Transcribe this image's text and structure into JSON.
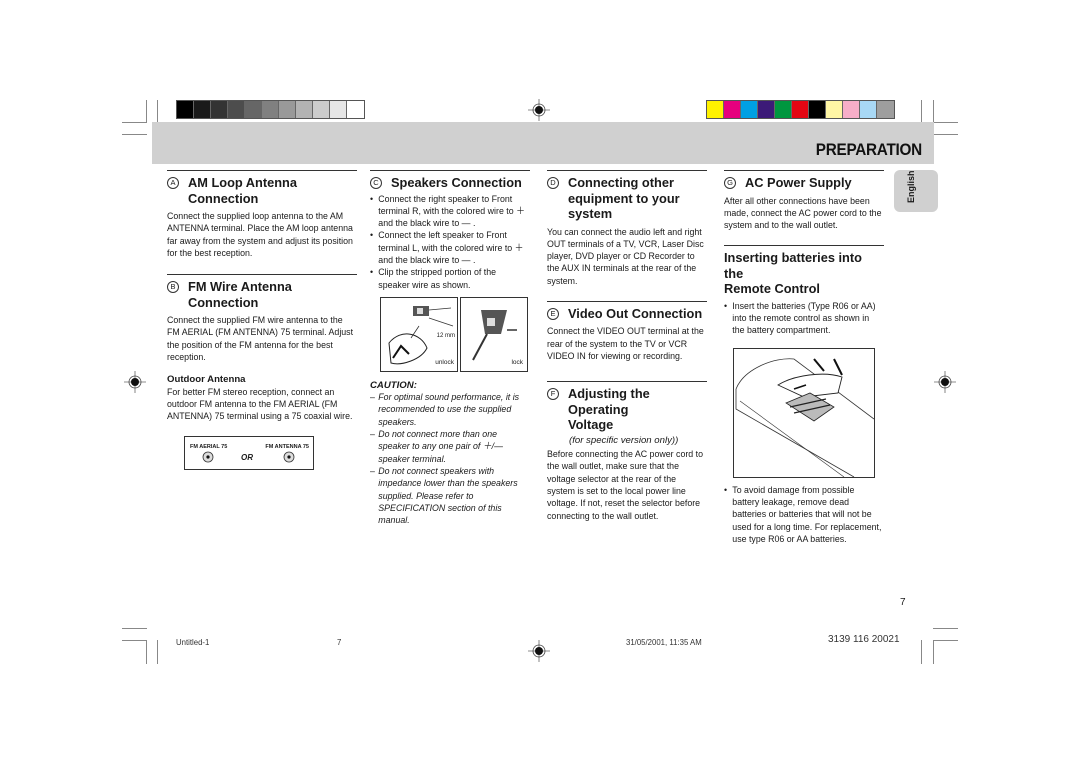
{
  "print_marks": {
    "gray_swatches": [
      "#000000",
      "#1a1a1a",
      "#333333",
      "#4d4d4d",
      "#666666",
      "#808080",
      "#999999",
      "#b3b3b3",
      "#cccccc",
      "#e6e6e6",
      "#ffffff"
    ],
    "color_swatches": [
      "#fff200",
      "#e6007e",
      "#00a0e3",
      "#3c1a78",
      "#00963f",
      "#e30613",
      "#000000",
      "#fff6a5",
      "#f7aec8",
      "#a8d8f5",
      "#9e9e9e"
    ]
  },
  "header": {
    "title": "PREPARATION"
  },
  "side_tab": {
    "label": "English"
  },
  "sections": {
    "a": {
      "letter": "A",
      "title_line1": "AM Loop Antenna",
      "title_line2": "Connection",
      "body": "Connect the supplied loop antenna to the AM ANTENNA terminal. Place the AM loop antenna far away from the system and adjust its position for the best reception."
    },
    "b": {
      "letter": "B",
      "title_line1": "FM Wire Antenna",
      "title_line2": "Connection",
      "body": "Connect the supplied FM wire antenna to the FM AERIAL (FM ANTENNA) 75 terminal. Adjust the position of the FM antenna for the best reception.",
      "sub_title": "Outdoor Antenna",
      "sub_body": "For better FM stereo reception, connect an outdoor FM antenna to the FM AERIAL (FM ANTENNA) 75    terminal using a 75 coaxial wire.",
      "figure": {
        "left_label": "FM AERIAL 75",
        "right_label": "FM ANTENNA 75",
        "or_label": "OR"
      }
    },
    "c": {
      "letter": "C",
      "title": "Speakers Connection",
      "bullets": [
        "Connect the right speaker to Front terminal R, with the colored wire to ＋ and the black wire to — .",
        "Connect the left speaker to Front terminal L, with the colored wire to ＋ and the black wire to — .",
        "Clip the stripped portion of the speaker wire as shown."
      ],
      "figure": {
        "measure": "12 mm",
        "unlock": "unlock",
        "lock": "lock"
      },
      "caution_title": "CAUTION:",
      "cautions": [
        "For optimal sound performance, it is recommended to use the supplied speakers.",
        "Do not connect more than one speaker to any one pair of ＋/— speaker terminal.",
        "Do not connect speakers with impedance lower than the speakers supplied.  Please refer to SPECIFICATION section of this manual."
      ]
    },
    "d": {
      "letter": "D",
      "title_line1": "Connecting other",
      "title_line2": "equipment to your system",
      "body": "You can connect the audio left and right OUT terminals of a  TV, VCR, Laser Disc player, DVD player or CD Recorder to the AUX IN terminals at the rear of the system."
    },
    "e": {
      "letter": "E",
      "title": "Video Out Connection",
      "body": "Connect the VIDEO OUT terminal at the rear of the system to the TV or VCR VIDEO IN for viewing or recording."
    },
    "f": {
      "letter": "F",
      "title_line1": "Adjusting the Operating",
      "title_line2": "Voltage",
      "note": "(for specific version only))",
      "body": "Before connecting the AC power cord to the wall outlet, make sure that the voltage selector at the rear of the system is set to the local power line voltage. If not, reset the selector before connecting to the wall outlet."
    },
    "g": {
      "letter": "G",
      "title": "AC Power Supply",
      "body": "After all other connections have been made, connect the AC power cord to the system and to the wall outlet."
    },
    "batteries": {
      "title_line1": "Inserting batteries into the",
      "title_line2": "Remote Control",
      "bullet1": "Insert the batteries  (Type R06 or AA) into the remote control as shown in the battery compartment.",
      "bullet2": "To avoid damage from possible battery leakage, remove dead batteries or batteries that will not be used for a long time. For replacement, use type R06 or AA batteries."
    }
  },
  "page_number": "7",
  "footer": {
    "file": "Untitled-1",
    "page": "7",
    "timestamp": "31/05/2001, 11:35 AM",
    "code": "3139 116 20021"
  }
}
